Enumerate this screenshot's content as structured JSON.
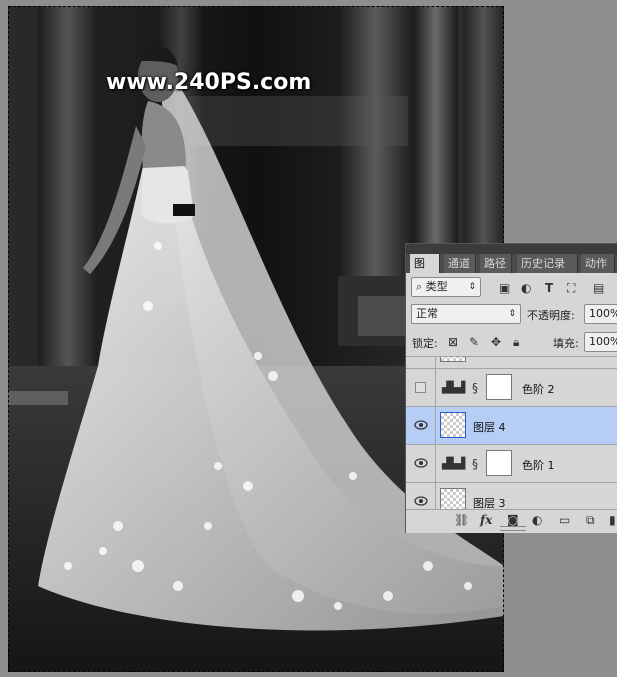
{
  "watermark": "www.240PS.com",
  "panel": {
    "tabs": [
      "图层",
      "通道",
      "路径",
      "历史记录",
      "动作"
    ],
    "filter": {
      "kind_label": "类型"
    },
    "blend_mode": "正常",
    "opacity_label": "不透明度:",
    "opacity_value": "100%",
    "lock_label": "锁定:",
    "fill_label": "填充:",
    "fill_value": "100%",
    "layers": [
      {
        "name": "色阶 2",
        "type": "adjustment",
        "visible": false,
        "selected": false
      },
      {
        "name": "图层 4",
        "type": "pixel",
        "visible": true,
        "selected": true
      },
      {
        "name": "色阶 1",
        "type": "adjustment",
        "visible": true,
        "selected": false
      },
      {
        "name": "图层 3",
        "type": "pixel",
        "visible": true,
        "selected": false
      }
    ],
    "footer_icons": [
      "link-icon",
      "fx-icon",
      "mask-icon",
      "adjustment-icon",
      "folder-icon",
      "new-layer-icon"
    ],
    "fx_label": "fx"
  },
  "colors": {
    "selection": "#b6cdf6",
    "panel": "#d6d6d6",
    "workspace": "#8e8e8e"
  }
}
